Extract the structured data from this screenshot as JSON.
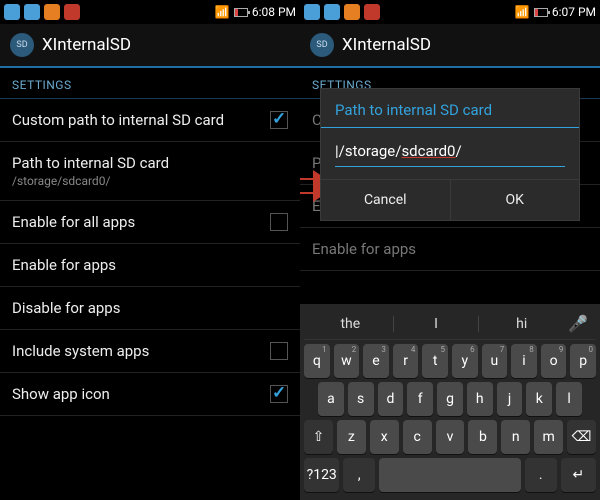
{
  "left": {
    "time": "6:08 PM",
    "app_title": "XInternalSD",
    "section": "SETTINGS",
    "items": [
      {
        "label": "Custom path to internal SD card",
        "sub": "",
        "checked": true
      },
      {
        "label": "Path to internal SD card",
        "sub": "/storage/sdcard0/",
        "checked": null
      },
      {
        "label": "Enable for all apps",
        "sub": "",
        "checked": false
      },
      {
        "label": "Enable for apps",
        "sub": "",
        "checked": null
      },
      {
        "label": "Disable for apps",
        "sub": "",
        "checked": null
      },
      {
        "label": "Include system apps",
        "sub": "",
        "checked": false
      },
      {
        "label": "Show app icon",
        "sub": "",
        "checked": true
      }
    ]
  },
  "right": {
    "time": "6:07 PM",
    "app_title": "XInternalSD",
    "section": "SETTINGS",
    "bg_items": [
      {
        "label": "Cu"
      },
      {
        "label": "P"
      },
      {
        "label": "Enable for all apps"
      },
      {
        "label": "Enable for apps"
      }
    ],
    "dialog": {
      "title": "Path to internal SD card",
      "value_prefix": "/storage/",
      "value_underlined": "sdcard0",
      "value_suffix": "/",
      "cancel": "Cancel",
      "ok": "OK"
    },
    "suggestions": [
      "the",
      "I",
      "hi"
    ],
    "keyboard": {
      "row1": [
        "q",
        "w",
        "e",
        "r",
        "t",
        "y",
        "u",
        "i",
        "o",
        "p"
      ],
      "row1_sup": [
        "1",
        "2",
        "3",
        "4",
        "5",
        "6",
        "7",
        "8",
        "9",
        "0"
      ],
      "row2": [
        "a",
        "s",
        "d",
        "f",
        "g",
        "h",
        "j",
        "k",
        "l"
      ],
      "row3_shift": "⇧",
      "row3": [
        "z",
        "x",
        "c",
        "v",
        "b",
        "n",
        "m"
      ],
      "row3_bksp": "⌫",
      "row4_sym": "?123",
      "row4_comma": ",",
      "row4_space": " ",
      "row4_period": ".",
      "row4_enter": "↵"
    }
  }
}
